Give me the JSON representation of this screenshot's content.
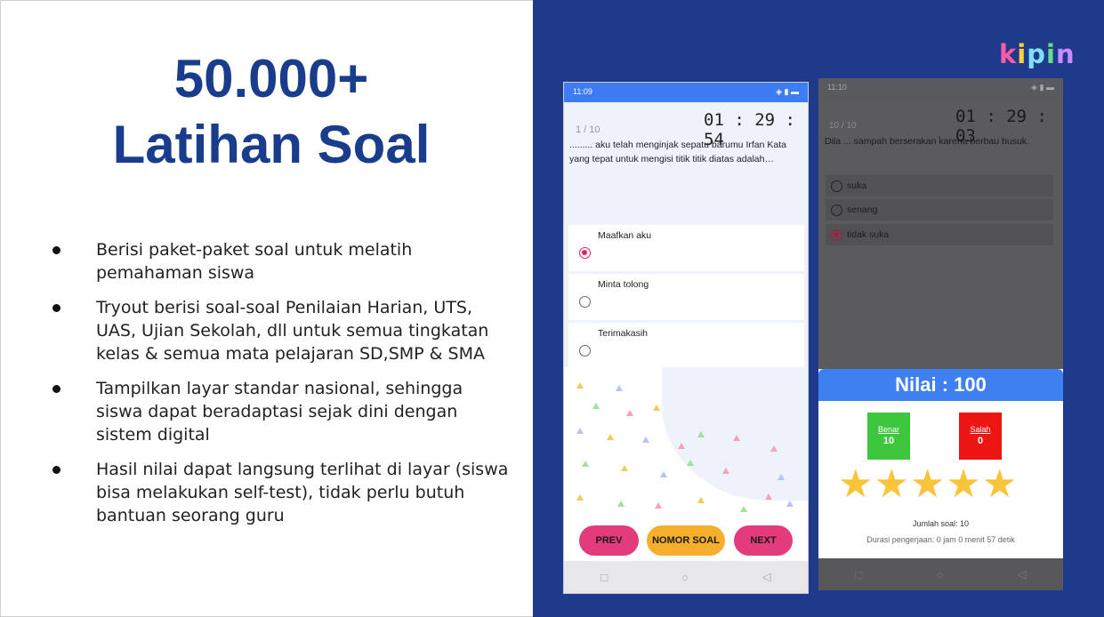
{
  "headline": {
    "line1": "50.000+",
    "line2": "Latihan Soal"
  },
  "bullets": [
    "Berisi paket-paket soal untuk melatih pemahaman siswa",
    "Tryout berisi soal-soal Penilaian Harian, UTS, UAS, Ujian Sekolah, dll  untuk semua tingkatan kelas  & semua mata pelajaran SD,SMP & SMA",
    "Tampilkan layar standar nasional, sehingga siswa dapat beradaptasi sejak dini dengan sistem digital",
    "Hasil nilai dapat langsung terlihat di layar (siswa bisa melakukan self-test), tidak perlu butuh bantuan seorang guru"
  ],
  "logo": [
    "k",
    "i",
    "p",
    "i",
    "n"
  ],
  "phone1": {
    "status_time": "11:09",
    "status_icons": "◈ ▮ ▬",
    "counter": "1 / 10",
    "timer": "01 : 29 : 54",
    "question": "......... aku telah menginjak sepatu barumu Irfan Kata yang tepat untuk mengisi titik titik diatas adalah…",
    "options": [
      "Maafkan aku",
      "Minta tolong",
      "Terimakasih"
    ],
    "selected_index": 0,
    "buttons": {
      "prev": "PREV",
      "nomor": "NOMOR SOAL",
      "next": "NEXT"
    },
    "nav": {
      "square": "□",
      "circle": "○",
      "back": "◁"
    }
  },
  "phone2": {
    "status_time": "11:10",
    "status_icons": "◈ ▮ ▬",
    "counter": "10 / 10",
    "timer": "01 : 29 : 03",
    "question": "Dila ... sampah berserakan karena berbau busuk.",
    "options": [
      "suka",
      "senang",
      "tidak suka"
    ],
    "selected_index": 2,
    "result": {
      "title": "Nilai : 100",
      "benar_label": "Benar",
      "benar_value": "10",
      "salah_label": "Salah",
      "salah_value": "0",
      "stars": 5,
      "total": "Jumlah soal: 10",
      "duration": "Durasi pengerjaan: 0 jam 0 menit 57 detik"
    },
    "nav": {
      "square": "□",
      "circle": "○",
      "back": "◁"
    }
  },
  "colors": {
    "headline": "#1a3c8c",
    "panel_bg": "#1f3a8a",
    "accent_pink": "#e33b7c",
    "accent_orange": "#f6ae2d",
    "star": "#f9c33a",
    "benar": "#3ec73e",
    "salah": "#ee1515"
  }
}
